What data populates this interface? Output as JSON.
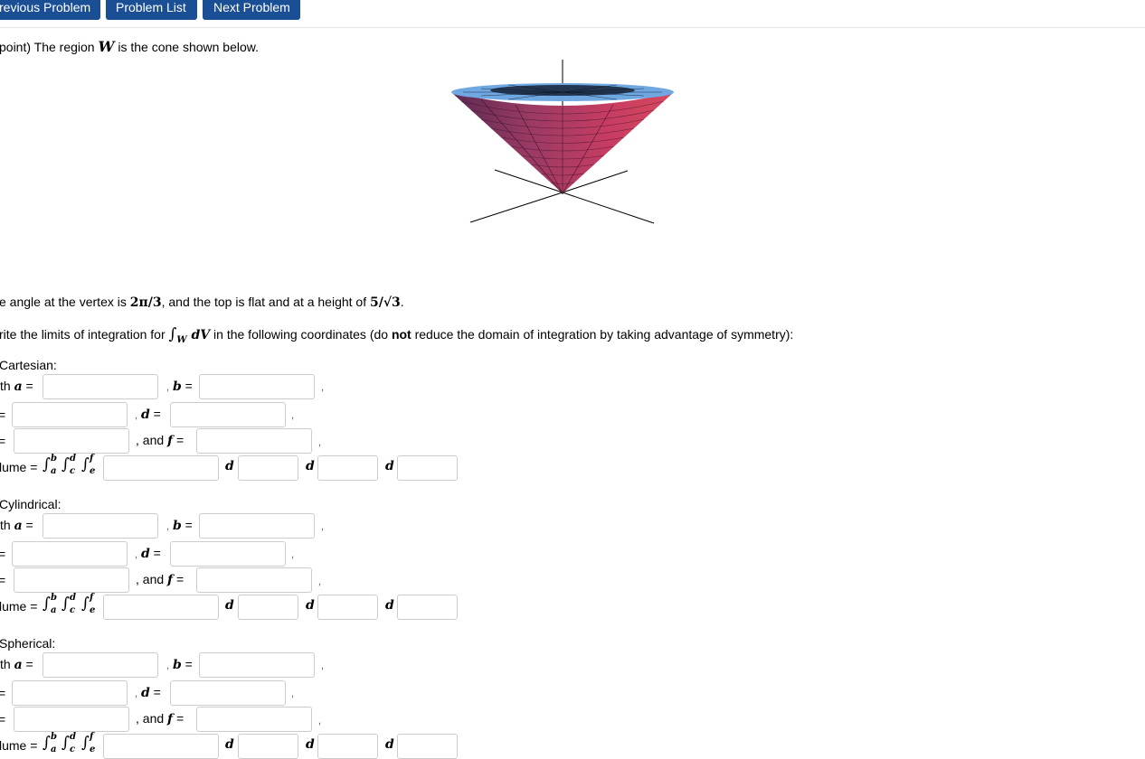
{
  "nav": {
    "prev_label": "revious Problem",
    "list_label": "Problem List",
    "next_label": "Next Problem",
    "btn_color": "#1a4f96"
  },
  "problem": {
    "intro_pre": "point) The region ",
    "intro_var": "W",
    "intro_post": " is the cone shown below.",
    "angle_pre": "e angle at the vertex is ",
    "angle_val": "2π/3",
    "angle_mid": ", and the top is flat and at a height of ",
    "height_val": "5/√3",
    "angle_end": ".",
    "write_pre": "rite the limits of integration for ",
    "write_int": "∫",
    "write_sub": "W",
    "write_dv": " dV",
    "write_mid": " in the following coordinates (do ",
    "write_bold": "not",
    "write_post": " reduce the domain of integration by taking advantage of symmetry):"
  },
  "labels": {
    "with_a": "th ",
    "a": "a",
    "eq": " =",
    "b": "b",
    "c_eq": "=",
    "d": "d",
    "e_eq": "=",
    "and": ", and ",
    "f": "f",
    "volume": "lume = ",
    "lim_a": "a",
    "lim_b": "b",
    "lim_c": "c",
    "lim_d": "d",
    "lim_e": "e",
    "lim_f": "f",
    "integral": "∫",
    "dvar": "d",
    "comma": ","
  },
  "sections": [
    {
      "title": " Cartesian:"
    },
    {
      "title": " Cylindrical:"
    },
    {
      "title": " Spherical:"
    }
  ],
  "figure": {
    "cone_top_color": "#6fa8e0",
    "cone_side_color": "#c23a63",
    "cone_dark_color": "#2a1020"
  }
}
